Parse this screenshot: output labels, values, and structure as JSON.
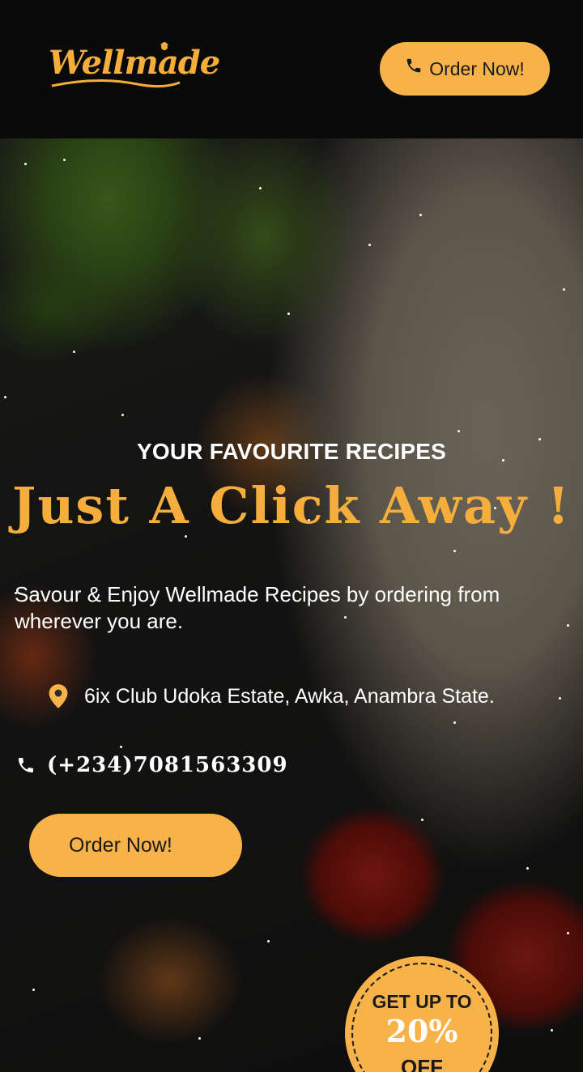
{
  "header": {
    "logo_text": "Wellmade",
    "order_button_label": "Order Now!"
  },
  "hero": {
    "eyebrow": "YOUR FAVOURITE RECIPES",
    "headline": "Just A Click Away !",
    "tagline": "Savour & Enjoy Wellmade Recipes by ordering from wherever you are.",
    "address": "6ix Club Udoka Estate, Awka, Anambra State.",
    "phone": "(+234)7081563309",
    "order_button_label": "Order Now!"
  },
  "badge": {
    "line1": "GET UP TO",
    "line2": "20%",
    "line3": "OFF"
  },
  "colors": {
    "accent": "#f7b24a",
    "header_bg": "#0a0a0a",
    "text_on_dark": "#ffffff"
  },
  "icons": {
    "header_button": "phone-icon",
    "address": "map-pin-icon",
    "phone": "phone-icon"
  }
}
